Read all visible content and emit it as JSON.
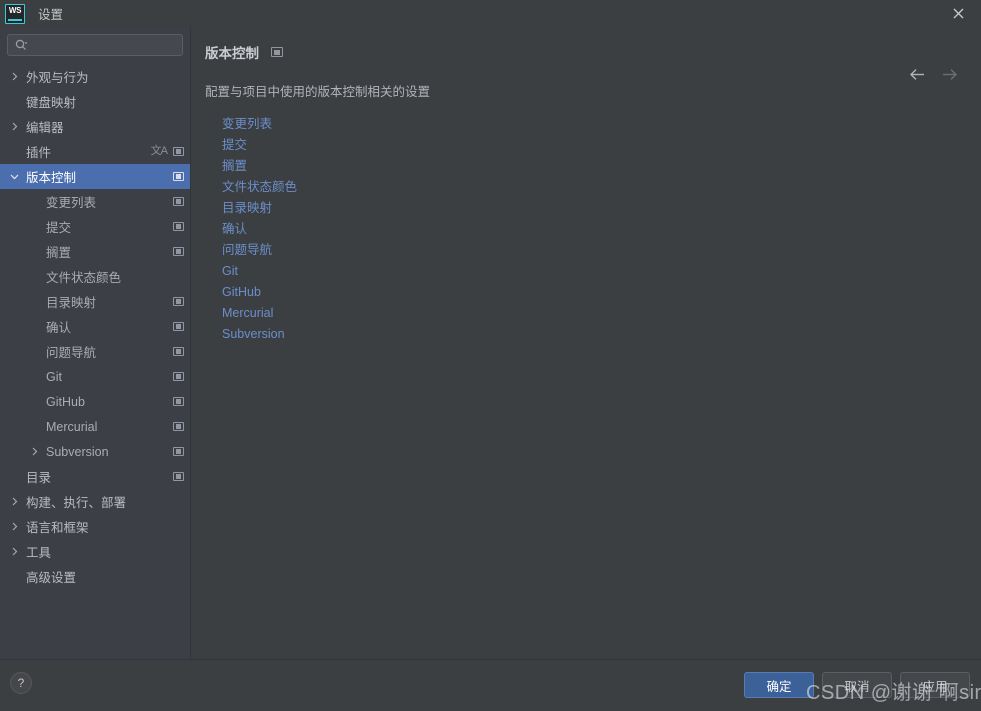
{
  "window": {
    "title": "设置",
    "app_icon": "webstorm-logo-icon",
    "close_icon": "close-icon"
  },
  "search": {
    "value": "",
    "placeholder": "",
    "icon": "search-icon"
  },
  "sidebar": {
    "items": [
      {
        "label": "外观与行为",
        "level": 0,
        "expandable": true,
        "expanded": false,
        "selected": false,
        "scope_icon": false,
        "translate_icon": false
      },
      {
        "label": "键盘映射",
        "level": 0,
        "expandable": false,
        "expanded": false,
        "selected": false,
        "scope_icon": false,
        "translate_icon": false
      },
      {
        "label": "编辑器",
        "level": 0,
        "expandable": true,
        "expanded": false,
        "selected": false,
        "scope_icon": false,
        "translate_icon": false
      },
      {
        "label": "插件",
        "level": 0,
        "expandable": false,
        "expanded": false,
        "selected": false,
        "scope_icon": true,
        "translate_icon": true
      },
      {
        "label": "版本控制",
        "level": 0,
        "expandable": true,
        "expanded": true,
        "selected": true,
        "scope_icon": true,
        "translate_icon": false
      },
      {
        "label": "变更列表",
        "level": 1,
        "expandable": false,
        "expanded": false,
        "selected": false,
        "scope_icon": true,
        "translate_icon": false
      },
      {
        "label": "提交",
        "level": 1,
        "expandable": false,
        "expanded": false,
        "selected": false,
        "scope_icon": true,
        "translate_icon": false
      },
      {
        "label": "搁置",
        "level": 1,
        "expandable": false,
        "expanded": false,
        "selected": false,
        "scope_icon": true,
        "translate_icon": false
      },
      {
        "label": "文件状态颜色",
        "level": 1,
        "expandable": false,
        "expanded": false,
        "selected": false,
        "scope_icon": false,
        "translate_icon": false
      },
      {
        "label": "目录映射",
        "level": 1,
        "expandable": false,
        "expanded": false,
        "selected": false,
        "scope_icon": true,
        "translate_icon": false
      },
      {
        "label": "确认",
        "level": 1,
        "expandable": false,
        "expanded": false,
        "selected": false,
        "scope_icon": true,
        "translate_icon": false
      },
      {
        "label": "问题导航",
        "level": 1,
        "expandable": false,
        "expanded": false,
        "selected": false,
        "scope_icon": true,
        "translate_icon": false
      },
      {
        "label": "Git",
        "level": 1,
        "expandable": false,
        "expanded": false,
        "selected": false,
        "scope_icon": true,
        "translate_icon": false
      },
      {
        "label": "GitHub",
        "level": 1,
        "expandable": false,
        "expanded": false,
        "selected": false,
        "scope_icon": true,
        "translate_icon": false
      },
      {
        "label": "Mercurial",
        "level": 1,
        "expandable": false,
        "expanded": false,
        "selected": false,
        "scope_icon": true,
        "translate_icon": false
      },
      {
        "label": "Subversion",
        "level": 1,
        "expandable": true,
        "expanded": false,
        "selected": false,
        "scope_icon": true,
        "translate_icon": false
      },
      {
        "label": "目录",
        "level": 0,
        "expandable": false,
        "expanded": false,
        "selected": false,
        "scope_icon": true,
        "translate_icon": false
      },
      {
        "label": "构建、执行、部署",
        "level": 0,
        "expandable": true,
        "expanded": false,
        "selected": false,
        "scope_icon": false,
        "translate_icon": false
      },
      {
        "label": "语言和框架",
        "level": 0,
        "expandable": true,
        "expanded": false,
        "selected": false,
        "scope_icon": false,
        "translate_icon": false
      },
      {
        "label": "工具",
        "level": 0,
        "expandable": true,
        "expanded": false,
        "selected": false,
        "scope_icon": false,
        "translate_icon": false
      },
      {
        "label": "高级设置",
        "level": 0,
        "expandable": false,
        "expanded": false,
        "selected": false,
        "scope_icon": false,
        "translate_icon": false
      }
    ]
  },
  "content": {
    "title": "版本控制",
    "scope_icon": "project-scope-icon",
    "description": "配置与项目中使用的版本控制相关的设置",
    "back_icon": "arrow-left-icon",
    "forward_icon": "arrow-right-icon",
    "links": [
      "变更列表",
      "提交",
      "搁置",
      "文件状态颜色",
      "目录映射",
      "确认",
      "问题导航",
      "Git",
      "GitHub",
      "Mercurial",
      "Subversion"
    ]
  },
  "footer": {
    "help_label": "?",
    "ok_label": "确定",
    "cancel_label": "取消",
    "apply_label": "应用"
  },
  "watermark": {
    "text": "CSDN @谢谢 啊sir"
  },
  "colors": {
    "window_bg": "#3c3f41",
    "sidebar_bg": "#3c3f46",
    "selection_blue": "#4b6eaf",
    "link_blue": "#6b8ecb",
    "primary_button": "#3c6199",
    "logo_accent": "#3ec9d6"
  }
}
